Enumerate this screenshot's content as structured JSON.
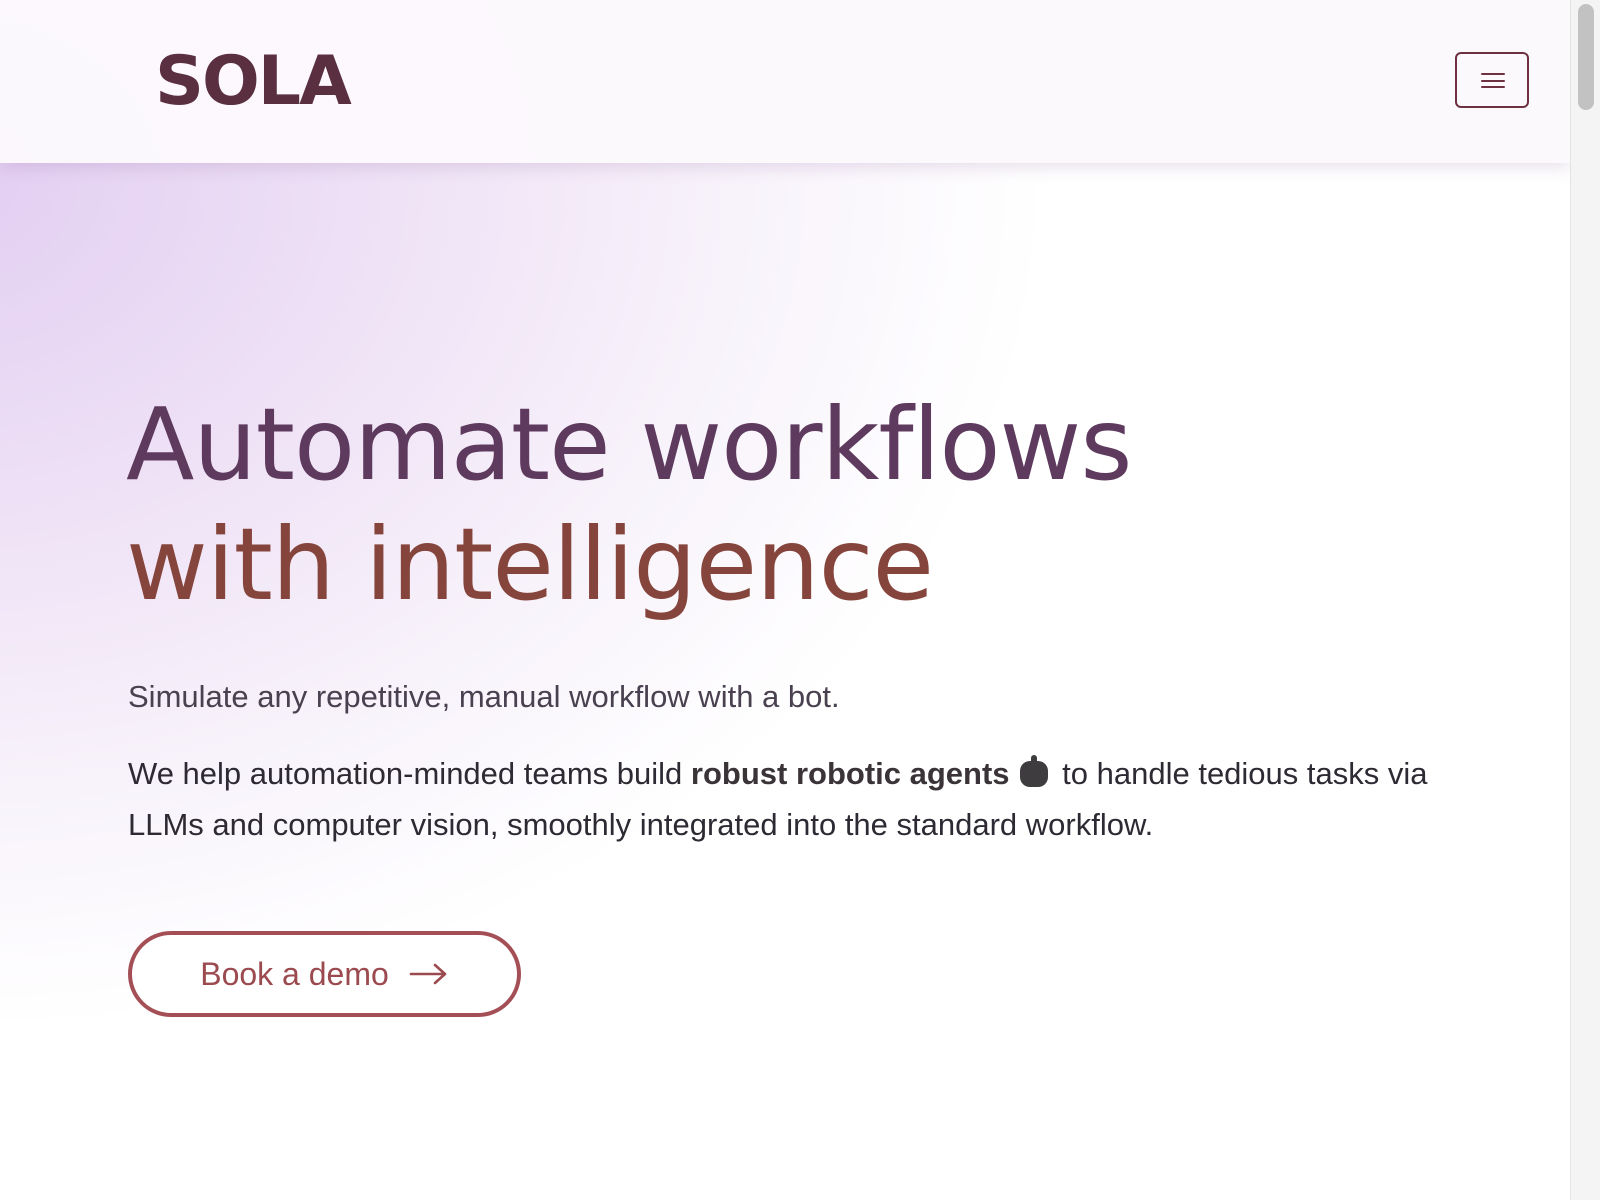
{
  "header": {
    "logo_text": "SOLA",
    "menu_button": "hamburger-menu-icon"
  },
  "hero": {
    "title_line1": "Automate workflows",
    "title_line2": "with intelligence",
    "subtitle": "Simulate any repetitive, manual workflow with a bot.",
    "description_before": "We help automation-minded teams build ",
    "description_bold": "robust robotic agents",
    "description_icon": "robot-icon",
    "description_after": " to handle tedious tasks via LLMs and computer vision, smoothly integrated into the standard workflow.",
    "cta_label": "Book a demo",
    "cta_icon": "arrow-right-icon"
  },
  "colors": {
    "brand_dark": "#5a2f40",
    "title_top": "#5e3a5e",
    "title_bottom": "#86453c",
    "cta_accent": "#a34f55",
    "background_tint": "#e2cdf2"
  }
}
